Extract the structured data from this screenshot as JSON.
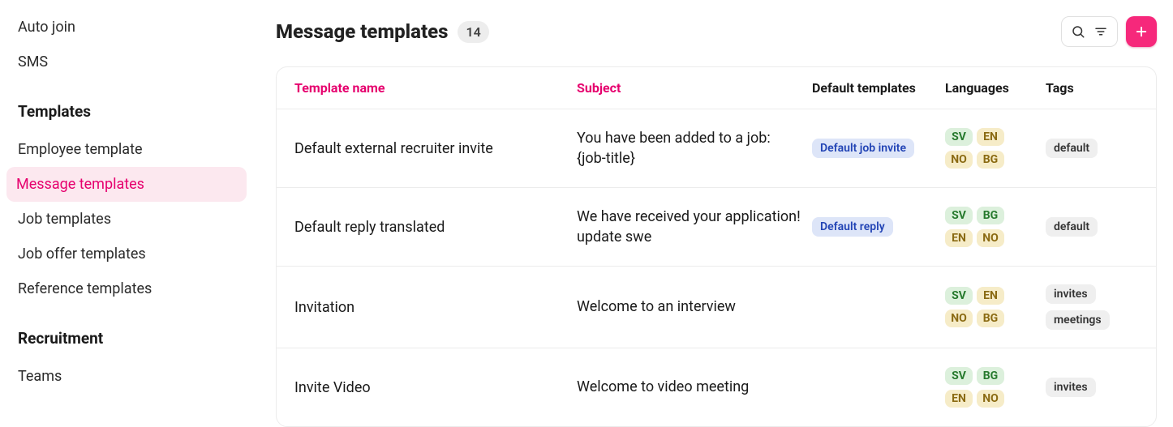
{
  "sidebar": {
    "top_items": [
      {
        "label": "Auto join"
      },
      {
        "label": "SMS"
      }
    ],
    "sections": [
      {
        "title": "Templates",
        "items": [
          {
            "label": "Employee template",
            "active": false
          },
          {
            "label": "Message templates",
            "active": true
          },
          {
            "label": "Job templates",
            "active": false
          },
          {
            "label": "Job offer templates",
            "active": false
          },
          {
            "label": "Reference templates",
            "active": false
          }
        ]
      },
      {
        "title": "Recruitment",
        "items": [
          {
            "label": "Teams",
            "active": false
          }
        ]
      }
    ]
  },
  "header": {
    "title": "Message templates",
    "count": "14"
  },
  "table": {
    "columns": {
      "name": "Template name",
      "subject": "Subject",
      "default": "Default templates",
      "languages": "Languages",
      "tags": "Tags"
    },
    "rows": [
      {
        "name": "Default external recruiter invite",
        "subject": "You have been added to a job: {job-title}",
        "defaults": [
          "Default job invite"
        ],
        "langs": [
          {
            "code": "SV",
            "color": "green"
          },
          {
            "code": "EN",
            "color": "yellow"
          },
          {
            "code": "NO",
            "color": "yellow"
          },
          {
            "code": "BG",
            "color": "yellow"
          }
        ],
        "tags": [
          "default"
        ]
      },
      {
        "name": "Default reply translated",
        "subject": "We have received your application! update swe",
        "defaults": [
          "Default reply"
        ],
        "langs": [
          {
            "code": "SV",
            "color": "green"
          },
          {
            "code": "BG",
            "color": "green"
          },
          {
            "code": "EN",
            "color": "yellow"
          },
          {
            "code": "NO",
            "color": "yellow"
          }
        ],
        "tags": [
          "default"
        ]
      },
      {
        "name": "Invitation",
        "subject": "Welcome to an interview",
        "defaults": [],
        "langs": [
          {
            "code": "SV",
            "color": "green"
          },
          {
            "code": "EN",
            "color": "yellow"
          },
          {
            "code": "NO",
            "color": "yellow"
          },
          {
            "code": "BG",
            "color": "yellow"
          }
        ],
        "tags": [
          "invites",
          "meetings"
        ]
      },
      {
        "name": "Invite Video",
        "subject": "Welcome to video meeting",
        "defaults": [],
        "langs": [
          {
            "code": "SV",
            "color": "green"
          },
          {
            "code": "BG",
            "color": "green"
          },
          {
            "code": "EN",
            "color": "yellow"
          },
          {
            "code": "NO",
            "color": "yellow"
          }
        ],
        "tags": [
          "invites"
        ]
      }
    ]
  }
}
